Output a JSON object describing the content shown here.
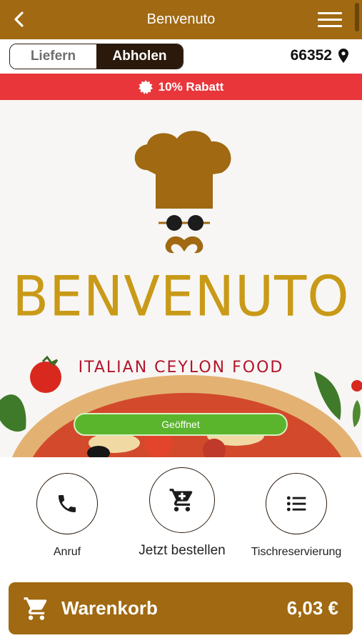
{
  "header": {
    "title": "Benvenuto"
  },
  "mode": {
    "options": [
      "Liefern",
      "Abholen"
    ],
    "selected": "Abholen",
    "postal_code": "66352"
  },
  "promo": {
    "text": "10% Rabatt"
  },
  "hero": {
    "brand": "BENVENUTO",
    "tagline": "ITALIAN CEYLON FOOD",
    "status": "Geöffnet"
  },
  "actions": [
    {
      "label": "Anruf",
      "icon": "phone-icon"
    },
    {
      "label": "Jetzt bestellen",
      "icon": "cart-icon"
    },
    {
      "label": "Tischreservierung",
      "icon": "list-icon"
    }
  ],
  "cart": {
    "label": "Warenkorb",
    "total": "6,03 €"
  },
  "colors": {
    "brand_brown": "#a06912",
    "dark_brown": "#2b1a0c",
    "promo_red": "#e8363b",
    "open_green": "#5bb52c",
    "logo_gold": "#c99a17",
    "tagline_red": "#b3142b"
  }
}
